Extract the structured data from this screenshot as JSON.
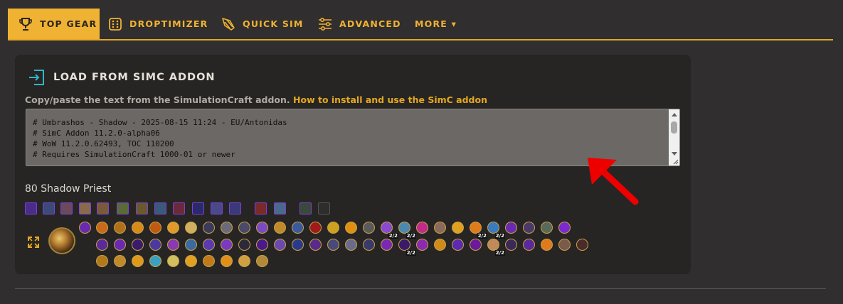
{
  "nav": {
    "tabs": [
      {
        "label": "TOP GEAR",
        "icon": "trophy-icon",
        "active": true
      },
      {
        "label": "DROPTIMIZER",
        "icon": "dice-icon",
        "active": false
      },
      {
        "label": "QUICK SIM",
        "icon": "quick-sim-icon",
        "active": false
      },
      {
        "label": "ADVANCED",
        "icon": "sliders-icon",
        "active": false
      },
      {
        "label": "MORE ▾",
        "icon": "",
        "active": false
      }
    ]
  },
  "card": {
    "title": "LOAD FROM SIMC ADDON",
    "title_icon": "import-icon",
    "help_text": "Copy/paste the text from the SimulationCraft addon.",
    "help_link": "How to install and use the SimC addon",
    "simc_text": "# Umbrashos - Shadow - 2025-08-15 11:24 - EU/Antonidas\n# SimC Addon 11.2.0-alpha06\n# WoW 11.2.0.62493, TOC 110200\n# Requires SimulationCraft 1000-01 or newer",
    "character": "80 Shadow Priest",
    "talent_ranks": [
      "2/2",
      "2/2",
      "2/2",
      "2/2",
      "2/2",
      "2/2"
    ]
  },
  "colors": {
    "accent": "#f0b232",
    "epic_border": "#7c3fd6",
    "background": "#302e2e",
    "card": "#272523",
    "arrow": "#ee0000"
  }
}
